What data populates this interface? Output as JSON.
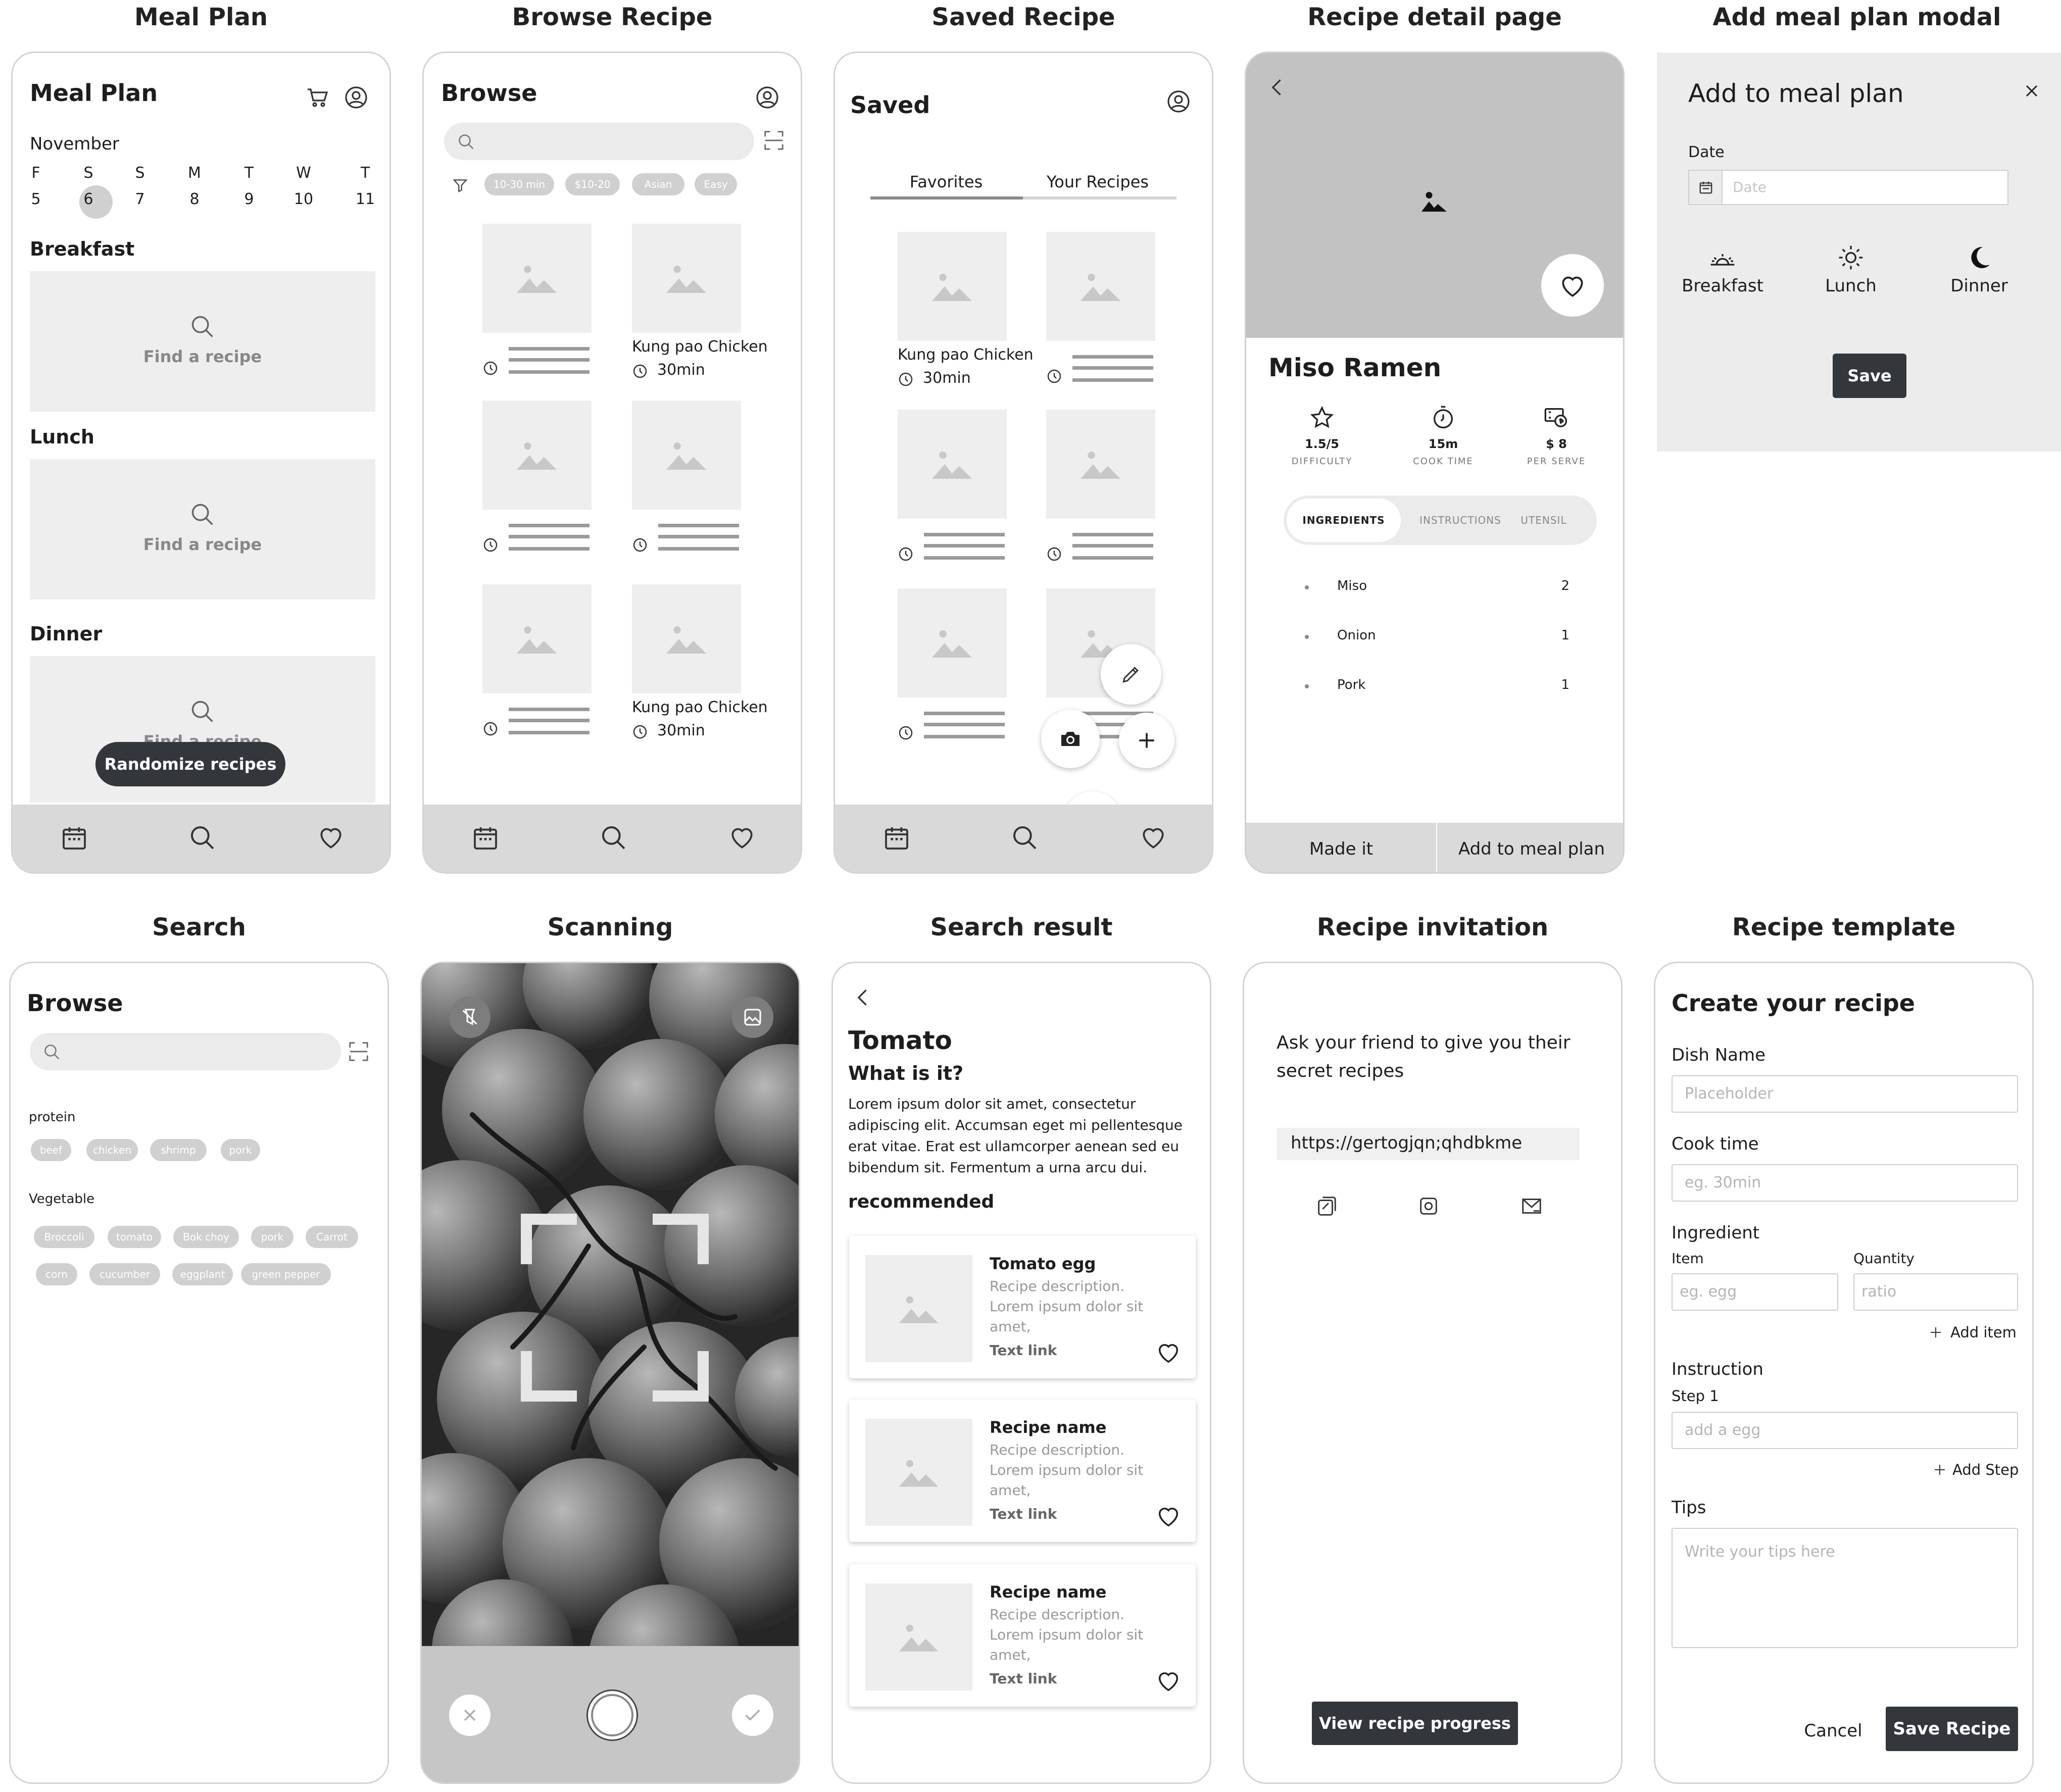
{
  "titles": {
    "meal_plan": "Meal Plan",
    "browse_recipe": "Browse Recipe",
    "saved_recipe": "Saved Recipe",
    "recipe_detail": "Recipe detail page",
    "add_meal_plan_modal": "Add meal plan modal",
    "search": "Search",
    "scanning": "Scanning",
    "search_result": "Search result",
    "recipe_invitation": "Recipe invitation",
    "recipe_template": "Recipe template"
  },
  "meal_plan": {
    "header": "Meal Plan",
    "month": "November",
    "days": [
      {
        "letter": "F",
        "num": "5"
      },
      {
        "letter": "S",
        "num": "6"
      },
      {
        "letter": "S",
        "num": "7"
      },
      {
        "letter": "M",
        "num": "8"
      },
      {
        "letter": "T",
        "num": "9"
      },
      {
        "letter": "W",
        "num": "10"
      },
      {
        "letter": "T",
        "num": "11"
      }
    ],
    "selected_day": "6",
    "breakfast": "Breakfast",
    "lunch": "Lunch",
    "dinner": "Dinner",
    "find_recipe": "Find a recipe",
    "randomize": "Randomize recipes"
  },
  "browse": {
    "header": "Browse",
    "filters": [
      "10-30 min",
      "$10-20",
      "Asian",
      "Easy"
    ],
    "card_name": "Kung pao Chicken",
    "card_time": "30min"
  },
  "saved": {
    "header": "Saved",
    "tabs": [
      "Favorites",
      "Your Recipes"
    ],
    "card_name": "Kung pao Chicken",
    "card_time": "30min"
  },
  "detail": {
    "name": "Miso Ramen",
    "stats": [
      {
        "value": "1.5/5",
        "label": "DIFFICULTY",
        "icon": "star-icon"
      },
      {
        "value": "15m",
        "label": "COOK TIME",
        "icon": "timer-icon"
      },
      {
        "value": "$ 8",
        "label": "PER SERVE",
        "icon": "money-icon"
      }
    ],
    "tabs": [
      "INGREDIENTS",
      "INSTRUCTIONS",
      "UTENSIL"
    ],
    "ingredients": [
      {
        "name": "Miso",
        "qty": "2"
      },
      {
        "name": "Onion",
        "qty": "1"
      },
      {
        "name": "Pork",
        "qty": "1"
      }
    ],
    "made_it": "Made it",
    "add_to_meal_plan": "Add to meal plan"
  },
  "modal": {
    "title": "Add to meal plan",
    "date_label": "Date",
    "date_placeholder": "Date",
    "meals": [
      "Breakfast",
      "Lunch",
      "Dinner"
    ],
    "save": "Save"
  },
  "search": {
    "header": "Browse",
    "protein_label": "protein",
    "protein": [
      "beef",
      "chicken",
      "shrimp",
      "pork"
    ],
    "vegetable_label": "Vegetable",
    "vegetables_row1": [
      "Broccoli",
      "tomato",
      "Bok choy",
      "pork",
      "Carrot"
    ],
    "vegetables_row2": [
      "corn",
      "cucumber",
      "eggplant",
      "green pepper"
    ]
  },
  "result": {
    "title": "Tomato",
    "subtitle": "What is it?",
    "description": "Lorem ipsum dolor sit amet, consectetur adipiscing elit. Accumsan eget mi pellentesque erat vitae. Erat est ullamcorper aenean sed eu bibendum sit. Fermentum a urna arcu dui.",
    "recommended": "recommended",
    "cards": [
      {
        "name": "Tomato egg",
        "desc": "Recipe description. Lorem ipsum dolor sit amet,",
        "link": "Text link"
      },
      {
        "name": "Recipe name",
        "desc": "Recipe description. Lorem ipsum dolor sit amet,",
        "link": "Text link"
      },
      {
        "name": "Recipe name",
        "desc": "Recipe description. Lorem ipsum dolor sit amet,",
        "link": "Text link"
      }
    ]
  },
  "invitation": {
    "text": "Ask your friend to give you their secret recipes",
    "link": "https://gertogjqn;qhdbkme",
    "button": "View recipe progress"
  },
  "template": {
    "header": "Create your recipe",
    "dish_label": "Dish Name",
    "dish_placeholder": "Placeholder",
    "cook_label": "Cook time",
    "cook_placeholder": "eg. 30min",
    "ingredient_label": "Ingredient",
    "item_label": "Item",
    "quantity_label": "Quantity",
    "item_placeholder": "eg. egg",
    "quantity_placeholder": "ratio",
    "add_item": "Add item",
    "instruction_label": "Instruction",
    "step_label": "Step 1",
    "step_placeholder": "add a egg",
    "add_step": "Add Step",
    "tips_label": "Tips",
    "tips_placeholder": "Write your tips here",
    "cancel": "Cancel",
    "save": "Save Recipe"
  }
}
